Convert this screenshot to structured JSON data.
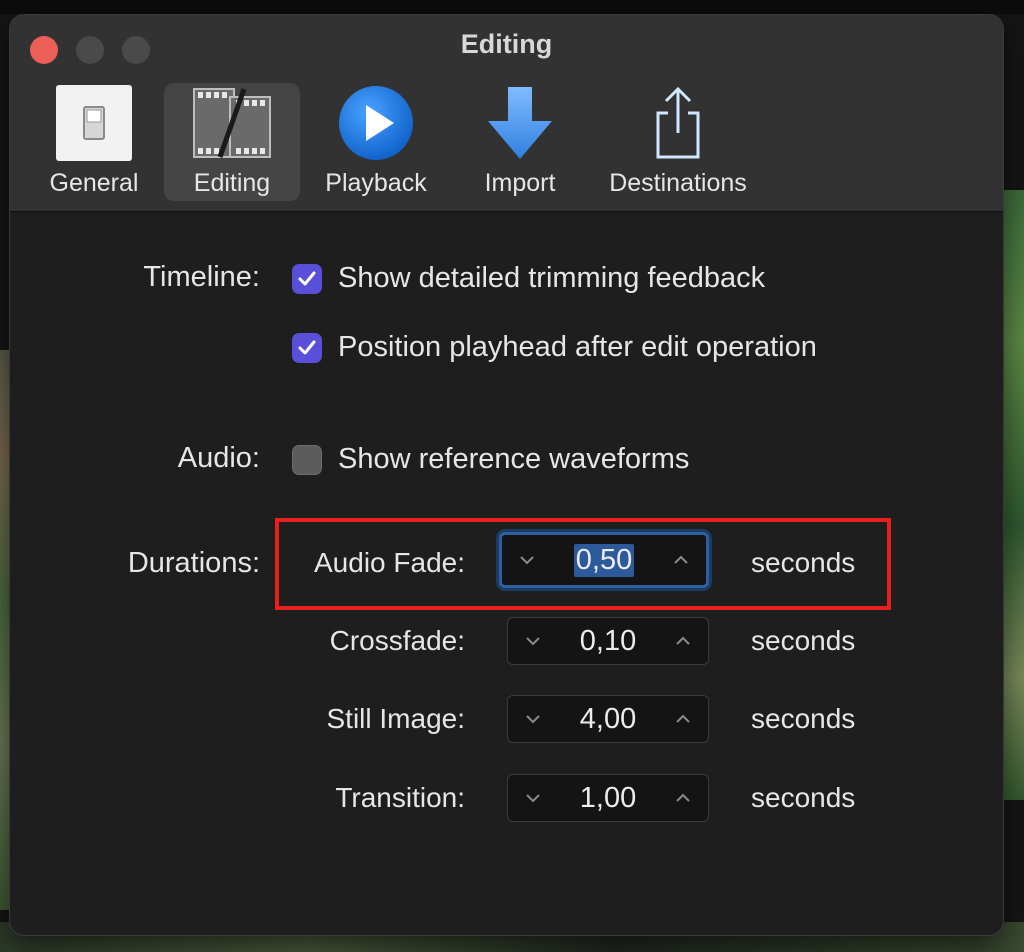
{
  "window": {
    "title": "Editing"
  },
  "tabs": [
    {
      "label": "General",
      "icon": "switch-icon"
    },
    {
      "label": "Editing",
      "icon": "film-strip-icon"
    },
    {
      "label": "Playback",
      "icon": "play-icon"
    },
    {
      "label": "Import",
      "icon": "down-arrow-icon"
    },
    {
      "label": "Destinations",
      "icon": "share-icon"
    }
  ],
  "timeline": {
    "label": "Timeline:",
    "options": [
      {
        "text": "Show detailed trimming feedback",
        "checked": true
      },
      {
        "text": "Position playhead after edit operation",
        "checked": true
      }
    ]
  },
  "audio": {
    "label": "Audio:",
    "option": {
      "text": "Show reference waveforms",
      "checked": false
    }
  },
  "durations": {
    "label": "Durations:",
    "fields": [
      {
        "label": "Audio Fade:",
        "value": "0,50",
        "unit": "seconds"
      },
      {
        "label": "Crossfade:",
        "value": "0,10",
        "unit": "seconds"
      },
      {
        "label": "Still Image:",
        "value": "4,00",
        "unit": "seconds"
      },
      {
        "label": "Transition:",
        "value": "1,00",
        "unit": "seconds"
      }
    ]
  },
  "colors": {
    "accent": "#5a4fd8",
    "focus": "#2e5e9e",
    "annotation": "#e8201c"
  }
}
